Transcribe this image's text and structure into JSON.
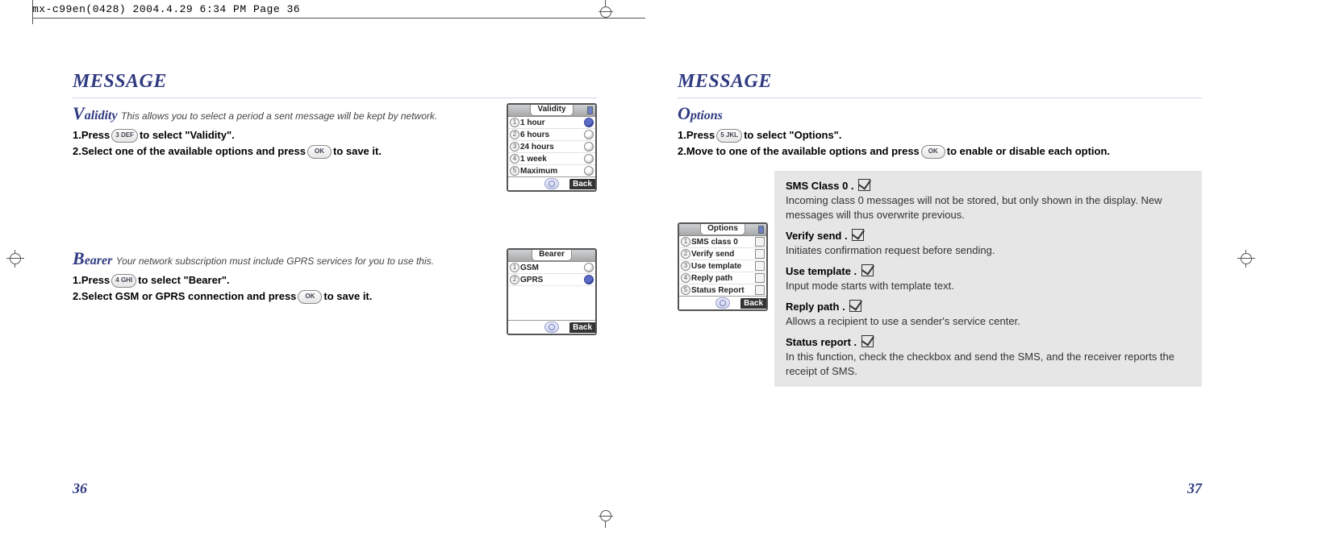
{
  "print_header": "mx-c99en(0428)  2004.4.29  6:34 PM  Page 36",
  "pages": {
    "left": {
      "title": "MESSAGE",
      "number": "36",
      "validity": {
        "heading_cap": "V",
        "heading_rest": "alidity",
        "heading_sub": " This allows you to select a period a sent message will be kept by network.",
        "step1_a": "1.Press ",
        "step1_key": "3 DEF",
        "step1_b": " to select \"Validity\".",
        "step2_a": "2.Select one of the available options and press ",
        "step2_key": "OK",
        "step2_b": " to save it."
      },
      "bearer": {
        "heading_cap": "B",
        "heading_rest": "earer",
        "heading_sub": " Your network subscription must include GPRS services for you to use this.",
        "step1_a": "1.Press ",
        "step1_key": "4 GHI",
        "step1_b": " to select \"Bearer\".",
        "step2_a": "2.Select GSM or GPRS connection and press ",
        "step2_key": "OK",
        "step2_b": " to save it."
      },
      "shot_validity": {
        "title": "Validity",
        "items": [
          "1 hour",
          "6 hours",
          "24 hours",
          "1 week",
          "Maximum"
        ],
        "selected_index": 0,
        "back": "Back"
      },
      "shot_bearer": {
        "title": "Bearer",
        "items": [
          "GSM",
          "GPRS"
        ],
        "selected_index": 1,
        "back": "Back"
      }
    },
    "right": {
      "title": "MESSAGE",
      "number": "37",
      "options": {
        "heading_cap": "O",
        "heading_rest": "ptions",
        "step1_a": "1.Press ",
        "step1_key": "5 JKL",
        "step1_b": " to select \"Options\".",
        "step2_a": "2.Move to one of the available options and press ",
        "step2_key": "OK",
        "step2_b": " to enable or disable each option."
      },
      "shot_options": {
        "title": "Options",
        "items": [
          "SMS class   0",
          "Verify send",
          "Use template",
          "Reply path",
          "Status Report"
        ],
        "back": "Back"
      },
      "defs": [
        {
          "title": "SMS Class 0 . ",
          "desc": "Incoming class 0 messages will not be stored, but only shown in the display. New messages will thus overwrite previous."
        },
        {
          "title": "Verify send . ",
          "desc": "Initiates confirmation request before sending."
        },
        {
          "title": "Use template . ",
          "desc": "Input mode starts with template text."
        },
        {
          "title": "Reply path . ",
          "desc": "Allows a recipient to use a sender's service center."
        },
        {
          "title": "Status report . ",
          "desc": "In this function, check the checkbox and send the SMS, and the receiver reports the receipt of SMS."
        }
      ]
    }
  }
}
